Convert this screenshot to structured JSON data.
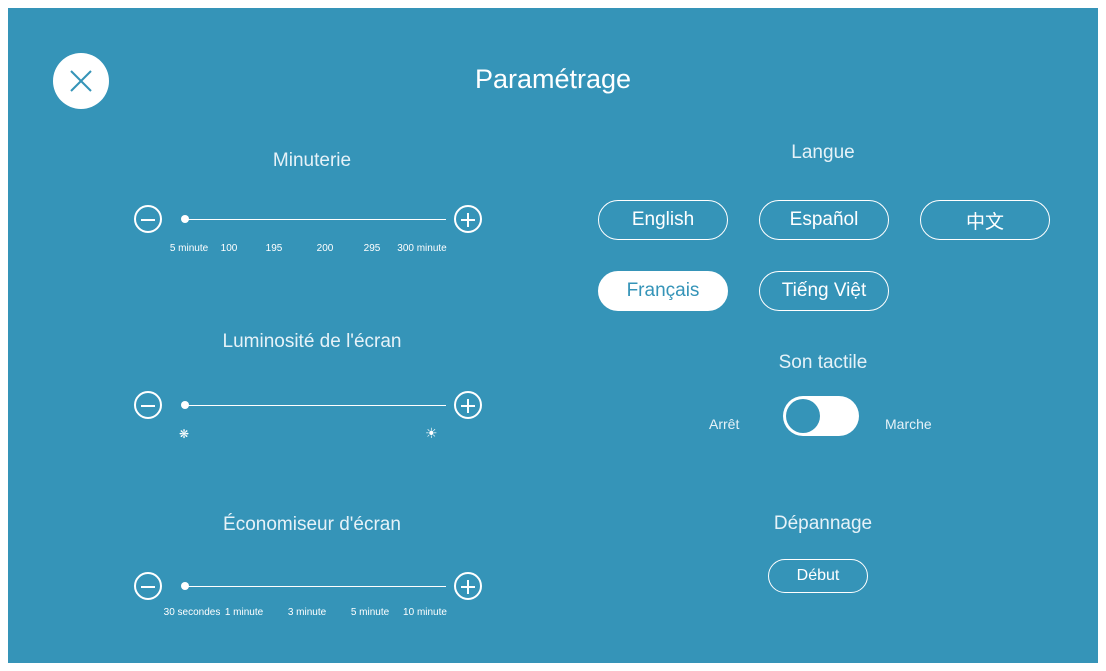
{
  "header": {
    "title": "Paramétrage"
  },
  "timer": {
    "label": "Minuterie",
    "ticks": [
      "5 minute",
      "100",
      "195",
      "200",
      "295",
      "300 minute"
    ]
  },
  "brightness": {
    "label": "Luminosité de l'écran",
    "min_icon": "dim-sun-icon",
    "max_icon": "bright-sun-icon"
  },
  "screensaver": {
    "label": "Économiseur d'écran",
    "ticks": [
      "30 secondes",
      "1 minute",
      "3 minute",
      "5 minute",
      "10 minute"
    ]
  },
  "language": {
    "label": "Langue",
    "options": [
      "English",
      "Español",
      "中文",
      "Français",
      "Tiếng Việt"
    ],
    "selected": "Français"
  },
  "touch_sound": {
    "label": "Son tactile",
    "off_label": "Arrêt",
    "on_label": "Marche",
    "state": "Arrêt"
  },
  "troubleshooting": {
    "label": "Dépannage",
    "button_label": "Début"
  },
  "colors": {
    "background": "#3594b8",
    "foreground": "#ffffff"
  }
}
